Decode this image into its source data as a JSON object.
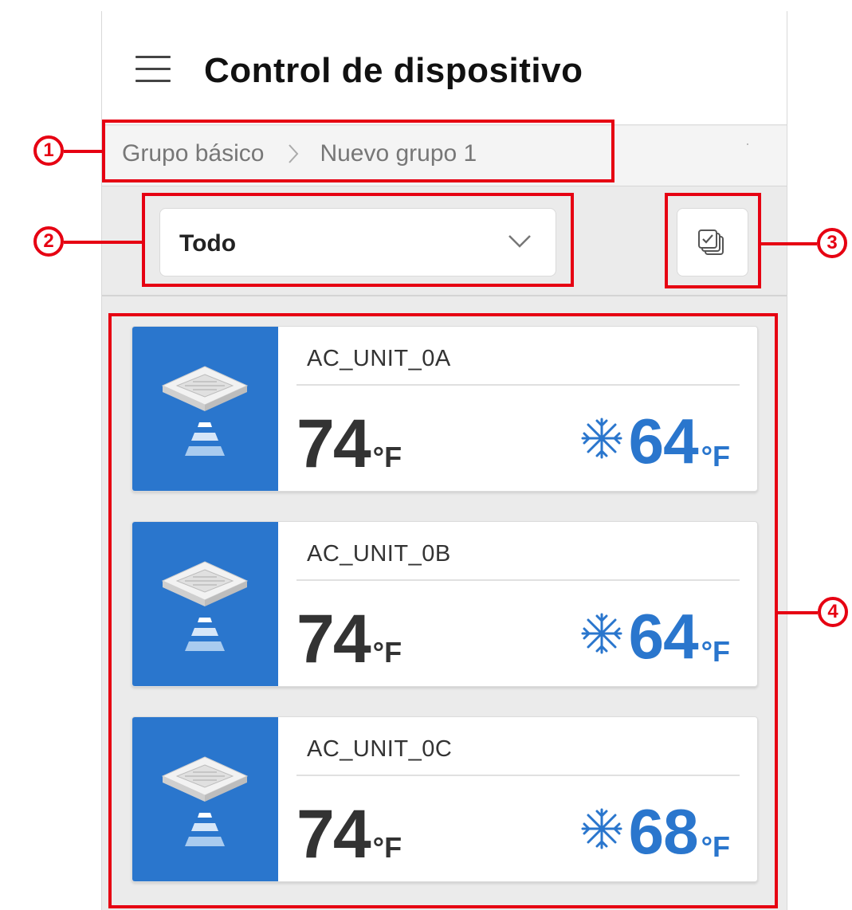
{
  "header": {
    "title": "Control de dispositivo"
  },
  "breadcrumb": {
    "items": [
      "Grupo básico",
      "Nuevo grupo 1"
    ]
  },
  "filter": {
    "selected": "Todo"
  },
  "devices": [
    {
      "name": "AC_UNIT_0A",
      "current_temp": "74",
      "current_unit": "°F",
      "set_temp": "64",
      "set_unit": "°F",
      "mode": "cool"
    },
    {
      "name": "AC_UNIT_0B",
      "current_temp": "74",
      "current_unit": "°F",
      "set_temp": "64",
      "set_unit": "°F",
      "mode": "cool"
    },
    {
      "name": "AC_UNIT_0C",
      "current_temp": "74",
      "current_unit": "°F",
      "set_temp": "68",
      "set_unit": "°F",
      "mode": "cool"
    }
  ],
  "annotations": [
    "1",
    "2",
    "3",
    "4"
  ],
  "colors": {
    "accent": "#2a76cd",
    "annotation": "#e60012"
  }
}
